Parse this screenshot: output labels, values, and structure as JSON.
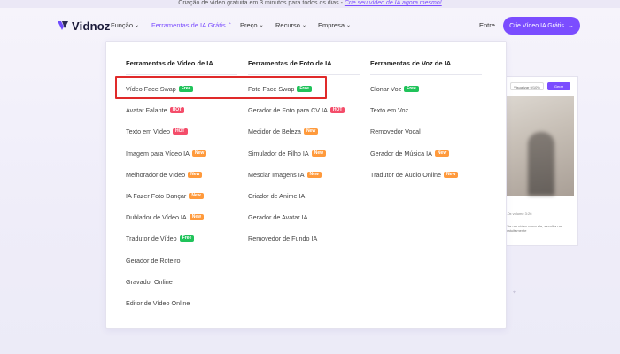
{
  "announcement": {
    "text": "Criação de vídeo gratuita em 3 minutos para todos os dias - ",
    "link": "Crie seu vídeo de IA agora mesmo!"
  },
  "header": {
    "logo": "Vidnoz",
    "nav": [
      {
        "label": "Função"
      },
      {
        "label": "Ferramentas de IA Grátis"
      },
      {
        "label": "Preço"
      },
      {
        "label": "Recurso"
      },
      {
        "label": "Empresa"
      }
    ],
    "login": "Entre",
    "cta": "Crie Vídeo IA Grátis"
  },
  "dropdown": {
    "columns": [
      {
        "title": "Ferramentas de Vídeo de IA",
        "items": [
          {
            "label": "Vídeo Face Swap",
            "badge": "Free"
          },
          {
            "label": "Avatar Falante",
            "badge": "HOT"
          },
          {
            "label": "Texto em Vídeo",
            "badge": "HOT"
          },
          {
            "label": "Imagem para Vídeo IA",
            "badge": "New"
          },
          {
            "label": "Melhorador de Vídeo",
            "badge": "New"
          },
          {
            "label": "IA Fazer Foto Dançar",
            "badge": "New"
          },
          {
            "label": "Dublador de Vídeo IA",
            "badge": "New"
          },
          {
            "label": "Tradutor de Vídeo",
            "badge": "Free"
          },
          {
            "label": "Gerador de Roteiro",
            "badge": ""
          },
          {
            "label": "Gravador Online",
            "badge": ""
          },
          {
            "label": "Editor de Vídeo Online",
            "badge": ""
          }
        ]
      },
      {
        "title": "Ferramentas de Foto de IA",
        "items": [
          {
            "label": "Foto Face Swap",
            "badge": "Free"
          },
          {
            "label": "Gerador de Foto para CV IA",
            "badge": "HOT"
          },
          {
            "label": "Medidor de Beleza",
            "badge": "New"
          },
          {
            "label": "Simulador de Filho IA",
            "badge": "New"
          },
          {
            "label": "Mesclar Imagens IA",
            "badge": "New"
          },
          {
            "label": "Criador de Anime IA",
            "badge": ""
          },
          {
            "label": "Gerador de Avatar IA",
            "badge": ""
          },
          {
            "label": "Removedor de Fundo IA",
            "badge": ""
          }
        ]
      },
      {
        "title": "Ferramentas de Voz de IA",
        "items": [
          {
            "label": "Clonar Voz",
            "badge": "Free"
          },
          {
            "label": "Texto em Voz",
            "badge": ""
          },
          {
            "label": "Removedor Vocal",
            "badge": ""
          },
          {
            "label": "Gerador de Música IA",
            "badge": "New"
          },
          {
            "label": "Tradutor de Áudio Online",
            "badge": "New"
          }
        ]
      }
    ]
  },
  "preview": {
    "btn1": "Visualizar 9/10%",
    "btn2": "Gerar",
    "controls": "1.0x   volume   3:26",
    "caption": "Crie um vídeo como ele, escolha um gratuitamente"
  },
  "colors": {
    "accent": "#7b4dff",
    "free": "#20c35a",
    "hot": "#f44d6a",
    "new": "#ff9a3c",
    "highlight": "#e02a2a"
  }
}
